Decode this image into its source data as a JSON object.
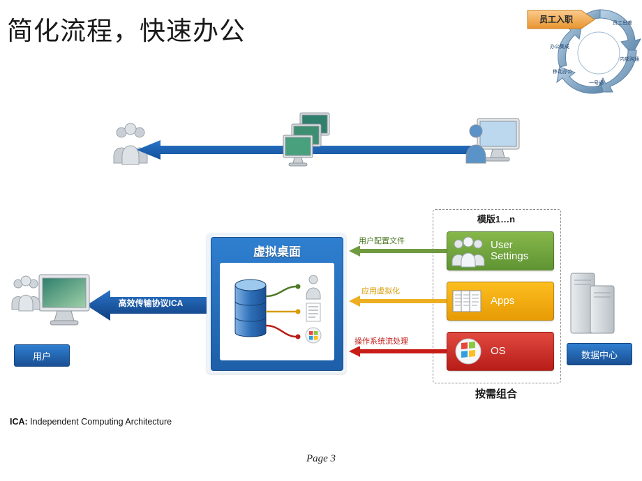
{
  "title": "简化流程，快速办公",
  "cycle": {
    "banner": "员工入职",
    "labels": [
      "员工出差",
      "内部沟通",
      "一号通",
      "移动办公",
      "办公集成"
    ]
  },
  "virtual_desktop": {
    "title": "虚拟桌面"
  },
  "ica": {
    "arrow_label": "高效传输协议ICA",
    "user_box": "用户"
  },
  "templates": {
    "title": "模版1…n",
    "combine": "按需组合",
    "items": [
      {
        "label": "User Settings",
        "color": "#6fa83c",
        "icon": "people-icon"
      },
      {
        "label": "Apps",
        "color": "#f0a81a",
        "icon": "apps-icon"
      },
      {
        "label": "OS",
        "color": "#cc2f28",
        "icon": "windows-icon"
      }
    ]
  },
  "connectors": [
    {
      "label": "用户配置文件",
      "color": "#4f7a28"
    },
    {
      "label": "应用虚拟化",
      "color": "#d99a00"
    },
    {
      "label": "操作系统流处理",
      "color": "#c01b16"
    }
  ],
  "datacenter": {
    "label": "数据中心"
  },
  "footnote": {
    "term": "ICA:",
    "text": " Independent Computing Architecture"
  },
  "page": "Page 3"
}
